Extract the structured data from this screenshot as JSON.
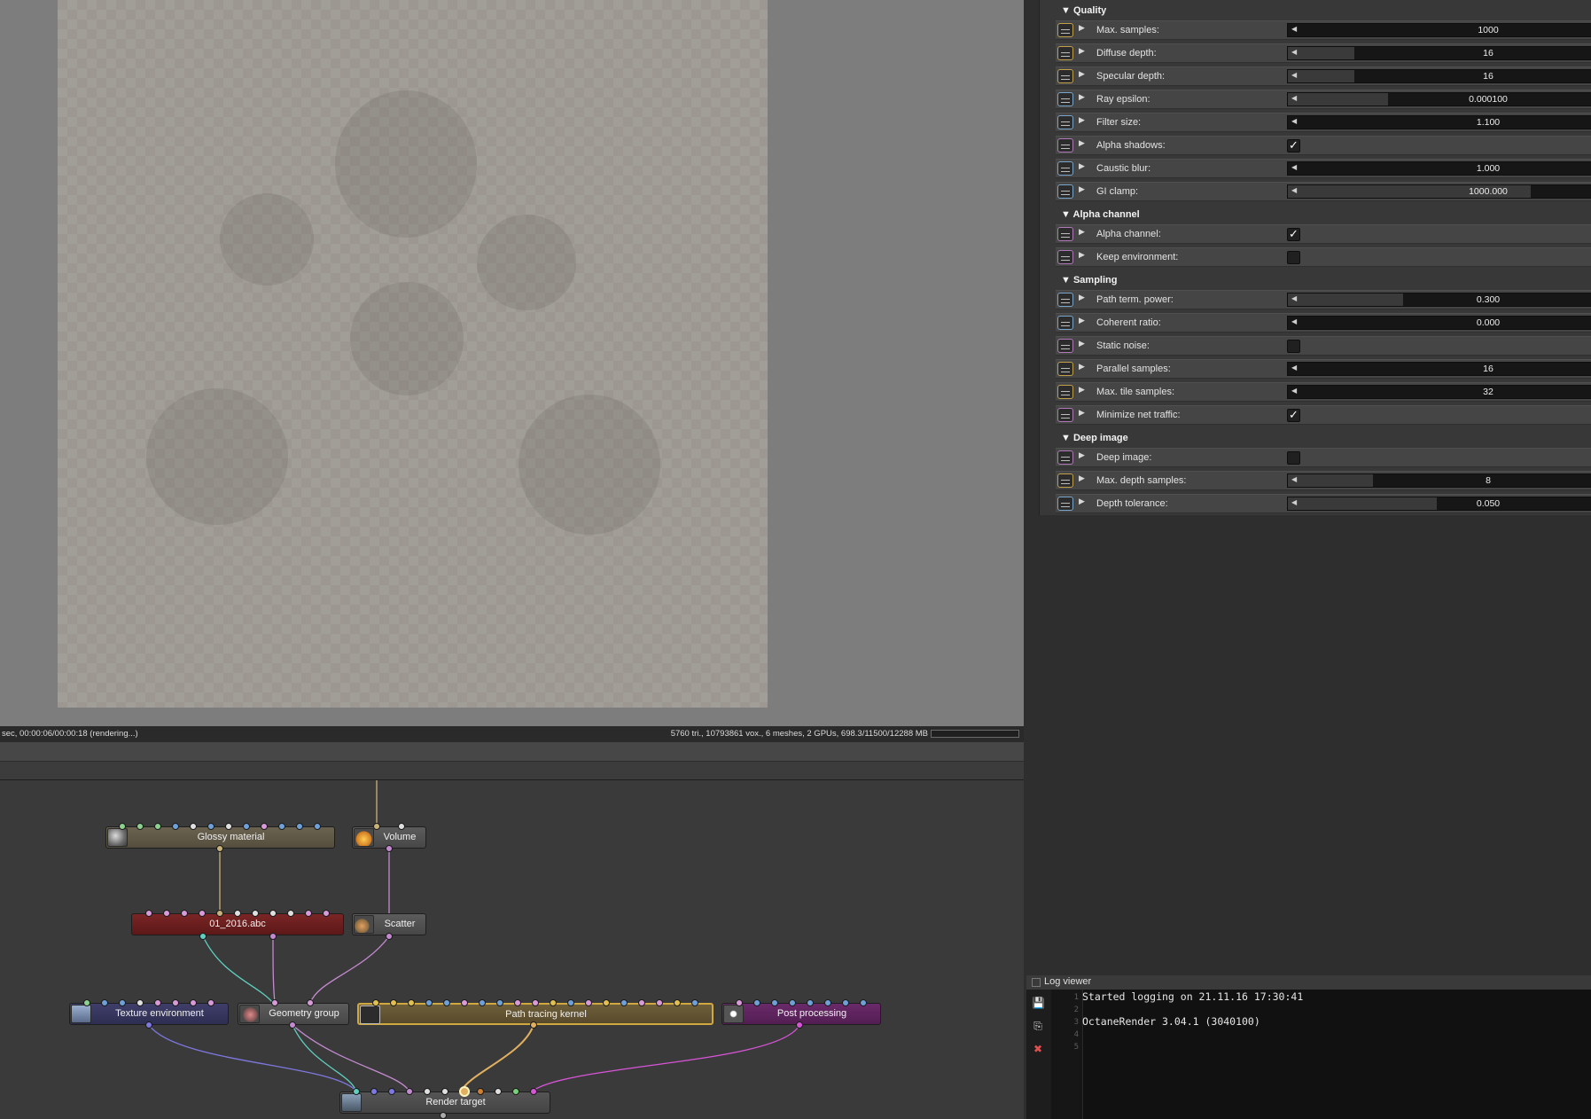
{
  "status": {
    "left": "sec, 00:00:06/00:00:18 (rendering...)",
    "right": "5760 tri., 10793861 vox., 6 meshes, 2 GPUs, 698.3/11500/12288 MB"
  },
  "graph": {
    "nodes": {
      "glossy": "Glossy material",
      "volume": "Volume",
      "abc": "01_2016.abc",
      "scatter": "Scatter",
      "texenv": "Texture environment",
      "geogroup": "Geometry group",
      "kernel": "Path tracing kernel",
      "post": "Post processing",
      "target": "Render target"
    }
  },
  "properties": {
    "sections": {
      "quality": "Quality",
      "alpha": "Alpha channel",
      "sampling": "Sampling",
      "deep": "Deep image"
    },
    "quality": {
      "max_samples": {
        "label": "Max. samples:",
        "value": "1000",
        "fill": 0.0
      },
      "diffuse_depth": {
        "label": "Diffuse depth:",
        "value": "16",
        "fill": 0.22
      },
      "specular_depth": {
        "label": "Specular depth:",
        "value": "16",
        "fill": 0.22
      },
      "ray_epsilon": {
        "label": "Ray epsilon:",
        "value": "0.000100",
        "fill": 0.33
      },
      "filter_size": {
        "label": "Filter size:",
        "value": "1.100",
        "fill": 0.0
      },
      "alpha_shadows": {
        "label": "Alpha shadows:",
        "checked": true
      },
      "caustic_blur": {
        "label": "Caustic blur:",
        "value": "1.000",
        "fill": 0.0
      },
      "gi_clamp": {
        "label": "GI clamp:",
        "value": "1000.000",
        "fill": 0.8
      }
    },
    "alpha": {
      "alpha_channel": {
        "label": "Alpha channel:",
        "checked": true
      },
      "keep_env": {
        "label": "Keep environment:",
        "checked": false
      }
    },
    "sampling": {
      "path_term": {
        "label": "Path term. power:",
        "value": "0.300",
        "fill": 0.38
      },
      "coherent": {
        "label": "Coherent ratio:",
        "value": "0.000",
        "fill": 0.0
      },
      "static_noise": {
        "label": "Static noise:",
        "checked": false
      },
      "parallel": {
        "label": "Parallel samples:",
        "value": "16",
        "fill": 0.0
      },
      "max_tile": {
        "label": "Max. tile samples:",
        "value": "32",
        "fill": 0.0
      },
      "min_net": {
        "label": "Minimize net traffic:",
        "checked": true
      }
    },
    "deep": {
      "deep_image": {
        "label": "Deep image:",
        "checked": false
      },
      "max_depth": {
        "label": "Max. depth samples:",
        "value": "8",
        "fill": 0.28
      },
      "depth_tol": {
        "label": "Depth tolerance:",
        "value": "0.050",
        "fill": 0.49
      }
    }
  },
  "log": {
    "title": "Log viewer",
    "line_numbers": [
      "1",
      "2",
      "3",
      "4",
      "5"
    ],
    "lines": [
      "Started logging on 21.11.16 17:30:41",
      "",
      "OctaneRender 3.04.1 (3040100)",
      "",
      ""
    ]
  },
  "checkmark": "✓"
}
